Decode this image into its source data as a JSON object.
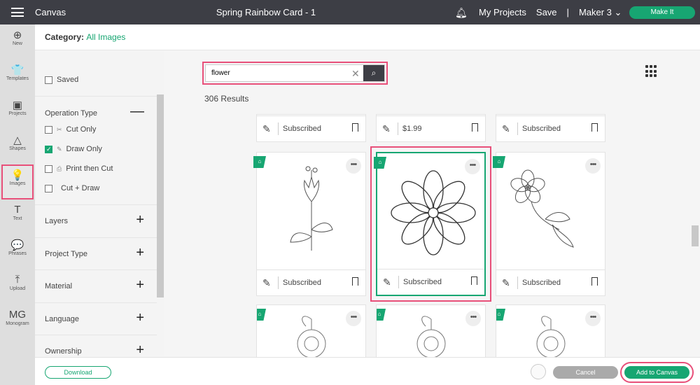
{
  "topbar": {
    "app": "Canvas",
    "title": "Spring Rainbow Card - 1",
    "my_projects": "My Projects",
    "save": "Save",
    "divider": "|",
    "machine": "Maker 3",
    "make_it": "Make It"
  },
  "rail": [
    {
      "label": "New",
      "icon": "⊕"
    },
    {
      "label": "Templates",
      "icon": "👕"
    },
    {
      "label": "Projects",
      "icon": "▣"
    },
    {
      "label": "Shapes",
      "icon": "△"
    },
    {
      "label": "Images",
      "icon": "💡"
    },
    {
      "label": "Text",
      "icon": "T"
    },
    {
      "label": "Phrases",
      "icon": "💬"
    },
    {
      "label": "Upload",
      "icon": "⤒"
    },
    {
      "label": "Monogram",
      "icon": "MG"
    }
  ],
  "category": {
    "label": "Category:",
    "value": "All Images"
  },
  "filters": {
    "saved": "Saved",
    "operation_type": "Operation Type",
    "options": [
      {
        "label": "Cut Only",
        "icon": "✂",
        "checked": false
      },
      {
        "label": "Draw Only",
        "icon": "✎",
        "checked": true
      },
      {
        "label": "Print then Cut",
        "icon": "⎙",
        "checked": false
      },
      {
        "label": "Cut + Draw",
        "icon": "",
        "checked": false
      }
    ],
    "sections": [
      "Layers",
      "Project Type",
      "Material",
      "Language",
      "Ownership"
    ]
  },
  "search": {
    "value": "flower"
  },
  "results": "306 Results",
  "cards": {
    "top": [
      "Subscribed",
      "$1.99",
      "Subscribed"
    ],
    "middle": [
      "Subscribed",
      "Subscribed",
      "Subscribed"
    ]
  },
  "bottom": {
    "download": "Download",
    "cancel": "Cancel",
    "add": "Add to Canvas"
  },
  "colors": {
    "accent": "#17a672",
    "highlight": "#e8507a",
    "topbar": "#3d3e45"
  }
}
